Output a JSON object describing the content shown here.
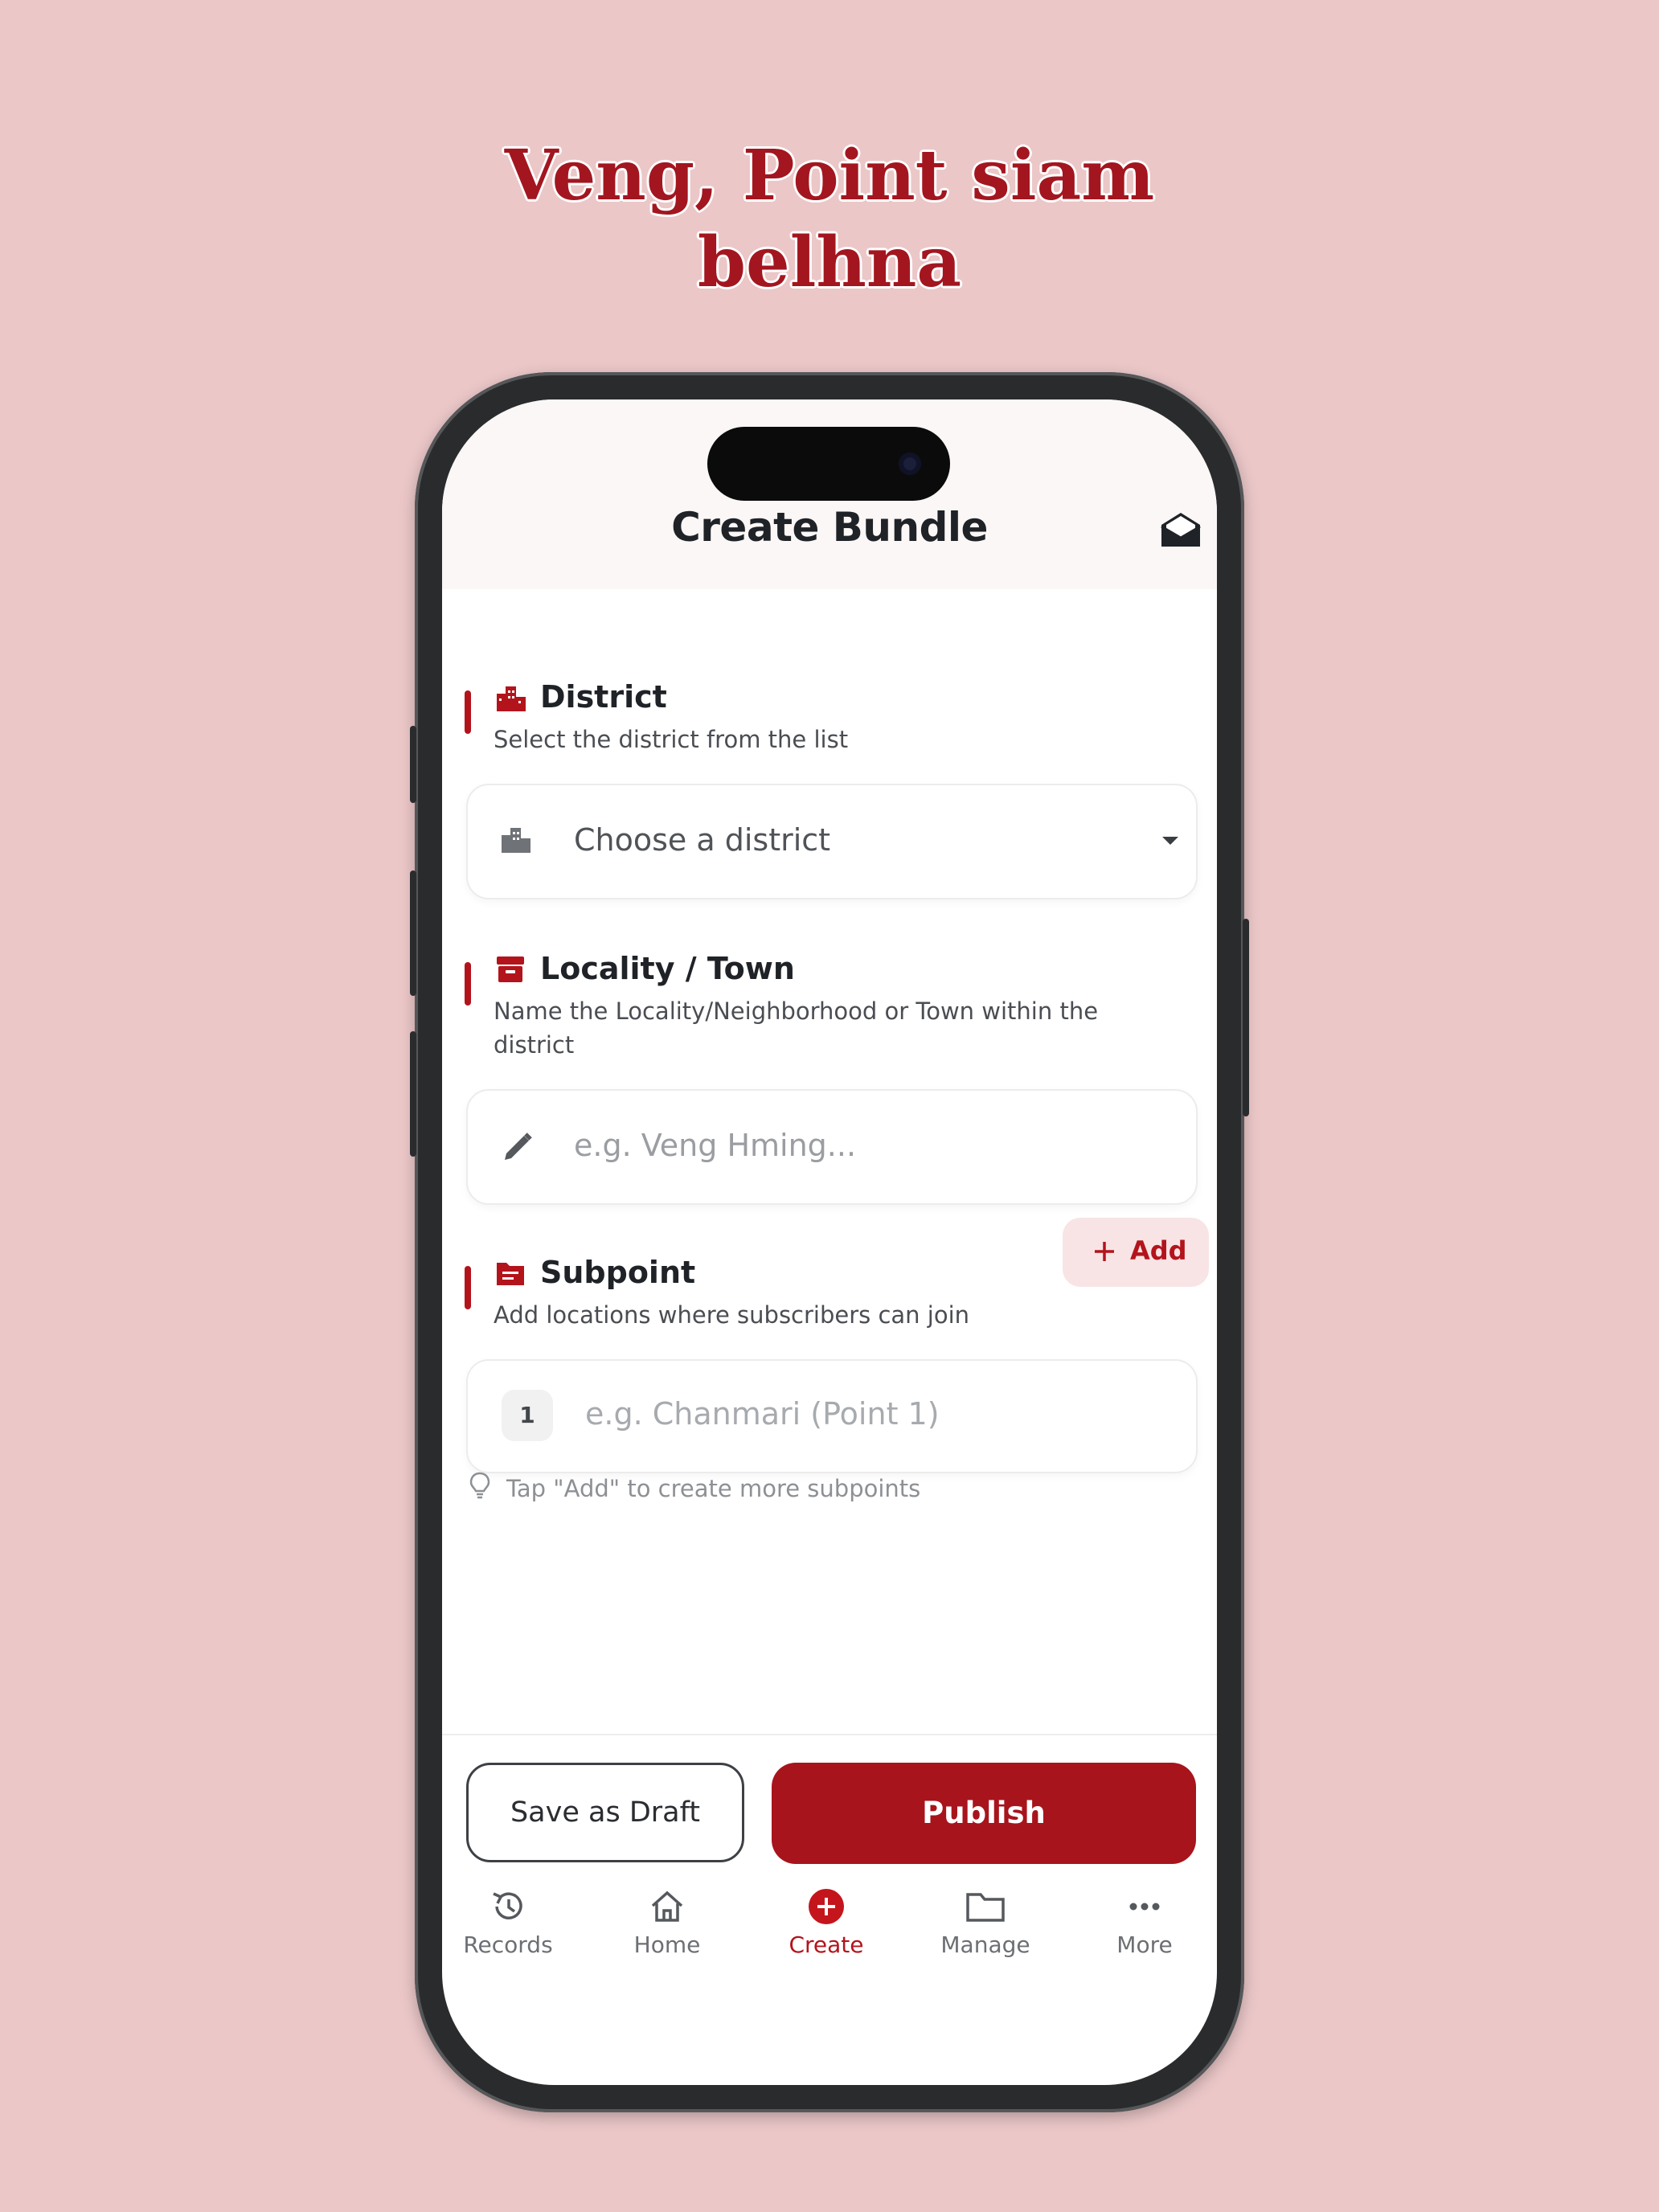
{
  "headline": {
    "line1": "Veng, Point siam",
    "line2": "belhna"
  },
  "appbar": {
    "title": "Create Bundle",
    "icon": "mail-open-icon"
  },
  "district": {
    "title": "District",
    "description": "Select the district from the list",
    "select_value": "Choose a district"
  },
  "locality": {
    "title": "Locality / Town",
    "description": "Name the Locality/Neighborhood or Town within the district",
    "placeholder": "e.g. Veng Hming..."
  },
  "subpoint": {
    "title": "Subpoint",
    "description": "Add locations where subscribers can join",
    "add_label": "Add",
    "items": [
      {
        "number": "1",
        "placeholder": "e.g. Chanmari (Point 1)"
      }
    ],
    "tip": "Tap \"Add\" to create more subpoints"
  },
  "actions": {
    "draft_label": "Save as Draft",
    "publish_label": "Publish"
  },
  "nav": {
    "items": [
      {
        "label": "Records",
        "icon": "history-icon"
      },
      {
        "label": "Home",
        "icon": "home-icon"
      },
      {
        "label": "Create",
        "icon": "add-circle-icon",
        "active": true
      },
      {
        "label": "Manage",
        "icon": "folder-icon"
      },
      {
        "label": "More",
        "icon": "more-icon"
      }
    ]
  },
  "colors": {
    "accent": "#a8141c",
    "background": "#ebc7c8",
    "tab_active": "#b3141c"
  }
}
